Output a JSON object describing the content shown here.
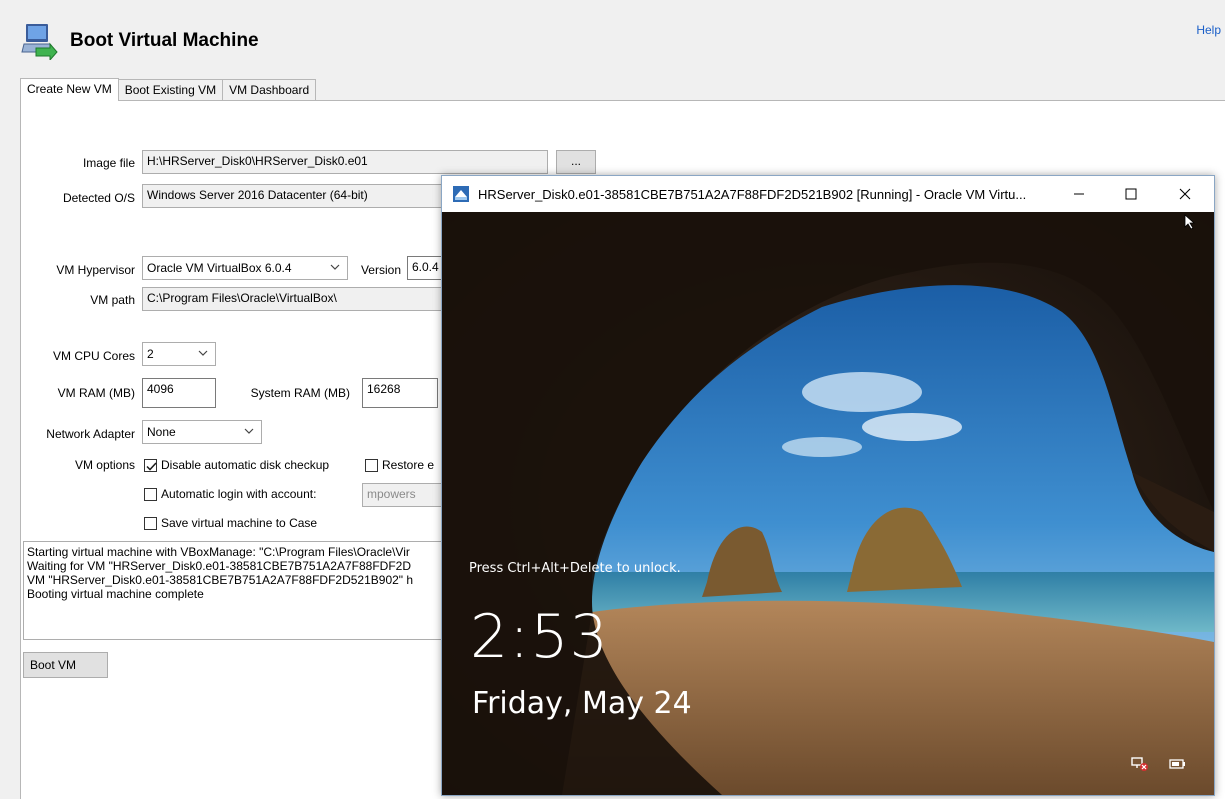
{
  "header": {
    "title": "Boot Virtual Machine",
    "help": "Help"
  },
  "tabs": [
    {
      "label": "Create New VM",
      "active": true
    },
    {
      "label": "Boot Existing VM",
      "active": false
    },
    {
      "label": "VM Dashboard",
      "active": false
    }
  ],
  "form": {
    "image_file_label": "Image file",
    "image_file_value": "H:\\HRServer_Disk0\\HRServer_Disk0.e01",
    "browse_label": "...",
    "detected_os_label": "Detected O/S",
    "detected_os_value": "Windows Server 2016 Datacenter (64-bit)",
    "hypervisor_label": "VM Hypervisor",
    "hypervisor_value": "Oracle VM VirtualBox 6.0.4",
    "version_label": "Version",
    "version_value": "6.0.4",
    "vm_path_label": "VM path",
    "vm_path_value": "C:\\Program Files\\Oracle\\VirtualBox\\",
    "cpu_label": "VM CPU Cores",
    "cpu_value": "2",
    "ram_label": "VM RAM (MB)",
    "ram_value": "4096",
    "sys_ram_label": "System RAM (MB)",
    "sys_ram_value": "16268",
    "network_label": "Network Adapter",
    "network_value": "None",
    "options_label": "VM options",
    "opt_disk_check": "Disable automatic disk checkup",
    "opt_restore": "Restore e",
    "opt_autologin": "Automatic login with account:",
    "autologin_account": "mpowers",
    "opt_save_case": "Save virtual machine to Case",
    "boot_button": "Boot VM"
  },
  "log": [
    "Starting virtual machine with VBoxManage: \"C:\\Program Files\\Oracle\\Vir",
    "Waiting for VM \"HRServer_Disk0.e01-38581CBE7B751A2A7F88FDF2D",
    "VM \"HRServer_Disk0.e01-38581CBE7B751A2A7F88FDF2D521B902\" h",
    "Booting virtual machine complete"
  ],
  "vm_window": {
    "title": "HRServer_Disk0.e01-38581CBE7B751A2A7F88FDF2D521B902 [Running] - Oracle VM Virtu...",
    "lock_hint": "Press Ctrl+Alt+Delete to unlock.",
    "time": "2:53",
    "date": "Friday, May 24"
  },
  "icons": {
    "app": "computer-with-green-arrow-icon",
    "vm_title": "virtualbox-icon",
    "minimize": "minimize-icon",
    "maximize": "maximize-icon",
    "close": "close-icon",
    "network_status": "network-disconnected-icon",
    "battery": "battery-icon"
  },
  "colors": {
    "help_link": "#1a5fc8",
    "check_mark": "#1a1a1a"
  }
}
